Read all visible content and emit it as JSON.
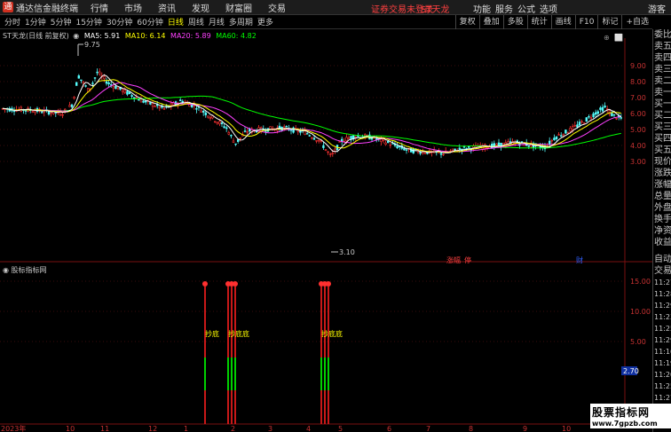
{
  "app": {
    "name": "通达信金融终端",
    "menu": [
      "行情",
      "市场",
      "资讯",
      "发现",
      "财富圈",
      "交易"
    ],
    "notice": "证券交易未登录",
    "stock": "ST天龙",
    "right_menu": [
      "功能",
      "服务",
      "公式",
      "选项"
    ],
    "guest": "游客"
  },
  "toolbar": {
    "periods": [
      "分时",
      "1分钟",
      "5分钟",
      "15分钟",
      "30分钟",
      "60分钟",
      "日线",
      "周线",
      "月线",
      "多周期",
      "更多"
    ],
    "active_period": "日线",
    "buttons": [
      "复权",
      "叠加",
      "多股",
      "统计",
      "画线",
      "F10",
      "标记",
      "+自选"
    ]
  },
  "main_chart": {
    "title": "ST天龙(日线 前复权)",
    "ma5": "MA5: 5.91",
    "ma10": "MA10: 6.14",
    "ma20": "MA20: 5.89",
    "ma60": "MA60: 4.82",
    "colors": {
      "ma5": "#ffffff",
      "ma10": "#ffff00",
      "ma20": "#ff40ff",
      "ma60": "#00ff00",
      "up": "#ff3232",
      "down": "#54fcfc"
    },
    "high_label": "9.75",
    "low_label": "3.10",
    "y_ticks": [
      "9.00",
      "8.00",
      "7.00",
      "6.00",
      "5.00",
      "4.00",
      "3.00"
    ],
    "event_labels": [
      "涨幅",
      "停",
      "财"
    ]
  },
  "sub_chart": {
    "title": "股标指标网",
    "y_ticks": [
      "15.00",
      "10.00",
      "5.00"
    ],
    "current_value": "2.70",
    "signal_label": "抄底",
    "signal_label_b": "抄底底",
    "signal_label_c": "抄底底"
  },
  "x_axis": [
    "2023年",
    "10",
    "11",
    "12",
    "1",
    "2",
    "3",
    "4",
    "5",
    "6",
    "7",
    "8",
    "9",
    "10"
  ],
  "right_panel": {
    "labels": [
      "委比",
      "卖五",
      "卖四",
      "卖三",
      "卖二",
      "卖一",
      "买一",
      "买二",
      "买三",
      "买四",
      "买五",
      "现价",
      "涨跌",
      "涨幅",
      "总量",
      "外盘",
      "换手",
      "净资",
      "收益"
    ],
    "labels2": [
      "自动",
      "交易"
    ],
    "times": [
      "11:27",
      "11:28",
      "11:29",
      "11:23",
      "11:25",
      "11:29",
      "11:16",
      "11:19",
      "11:20",
      "11:25",
      "11:27"
    ]
  },
  "watermark": {
    "line1": "股票指标网",
    "line2": "www.7gpzb.com"
  }
}
